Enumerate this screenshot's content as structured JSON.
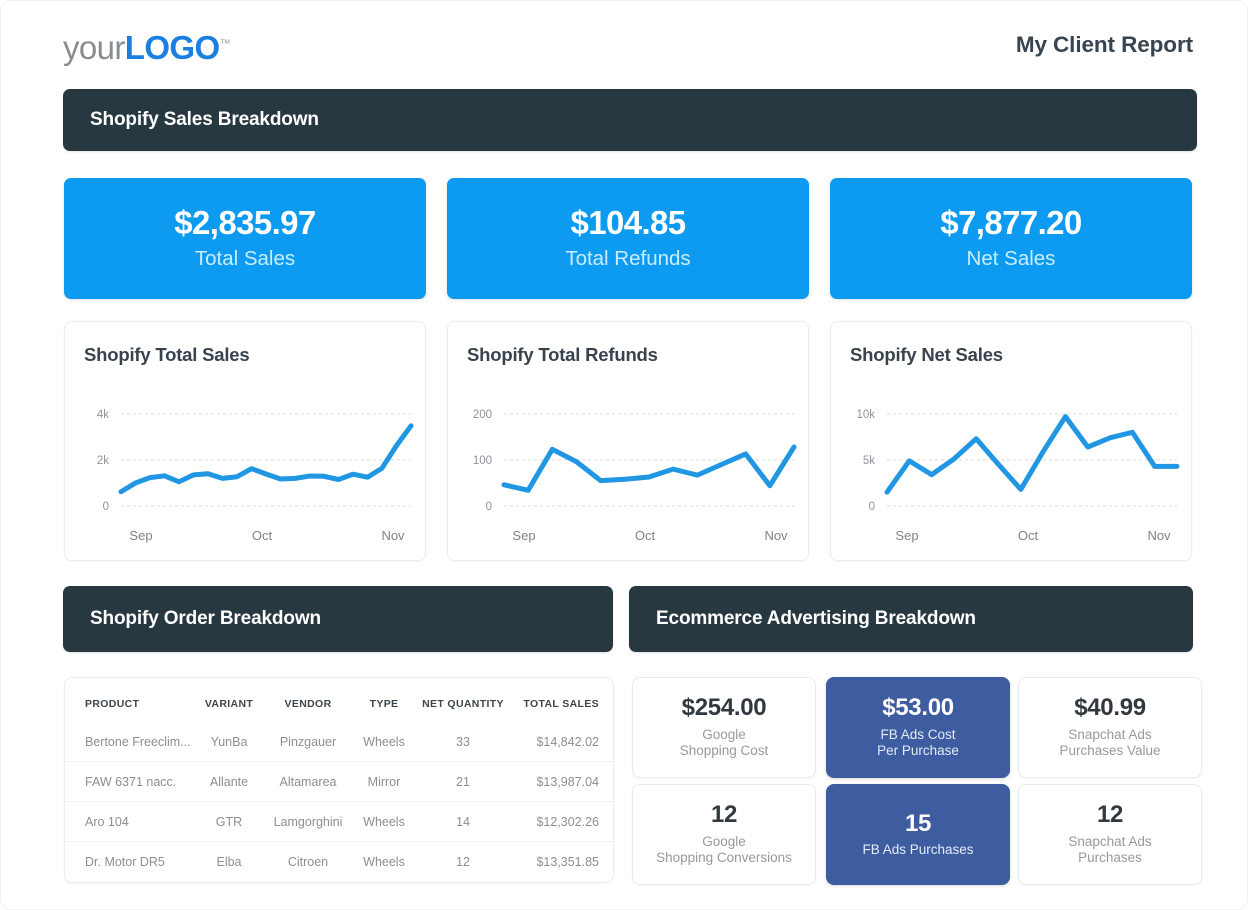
{
  "header": {
    "logo_primary": "your",
    "logo_accent": "LOGO",
    "logo_tm": "™",
    "report_title": "My Client Report"
  },
  "sections": {
    "sales_breakdown": "Shopify Sales Breakdown",
    "order_breakdown": "Shopify Order Breakdown",
    "advertising_breakdown": "Ecommerce Advertising Breakdown"
  },
  "colors": {
    "accent_blue": "#0d9bf2",
    "dark_bar": "#283841",
    "line_blue": "#2196e3",
    "fb_card_blue": "#3e5ca0"
  },
  "kpis": [
    {
      "value": "$2,835.97",
      "label": "Total Sales"
    },
    {
      "value": "$104.85",
      "label": "Total Refunds"
    },
    {
      "value": "$7,877.20",
      "label": "Net Sales"
    }
  ],
  "ad_cards": [
    {
      "value": "$254.00",
      "label": "Google\nShopping Cost",
      "style": "light"
    },
    {
      "value": "$53.00",
      "label": "FB Ads Cost\nPer Purchase",
      "style": "dark"
    },
    {
      "value": "$40.99",
      "label": "Snapchat Ads\nPurchases Value",
      "style": "light"
    },
    {
      "value": "12",
      "label": "Google\nShopping Conversions",
      "style": "light"
    },
    {
      "value": "15",
      "label": "FB Ads Purchases",
      "style": "dark"
    },
    {
      "value": "12",
      "label": "Snapchat Ads\nPurchases",
      "style": "light"
    }
  ],
  "order_table": {
    "columns": [
      "PRODUCT",
      "VARIANT",
      "VENDOR",
      "TYPE",
      "NET QUANTITY",
      "TOTAL SALES"
    ],
    "rows": [
      [
        "Bertone Freeclim...",
        "YunBa",
        "Pinzgauer",
        "Wheels",
        "33",
        "$14,842.02"
      ],
      [
        "FAW 6371 nacc.",
        "Allante",
        "Altamarea",
        "Mirror",
        "21",
        "$13,987.04"
      ],
      [
        "Aro 104",
        "GTR",
        "Lamgorghini",
        "Wheels",
        "14",
        "$12,302.26"
      ],
      [
        "Dr. Motor DR5",
        "Elba",
        "Citroen",
        "Wheels",
        "12",
        "$13,351.85"
      ]
    ]
  },
  "chart_data": [
    {
      "type": "line",
      "title": "Shopify Total Sales",
      "xlabel": "",
      "ylabel": "",
      "ylim": [
        0,
        4600
      ],
      "yticks": [
        0,
        2000,
        4000
      ],
      "ytick_labels": [
        "0",
        "2k",
        "4k"
      ],
      "xticks": [
        0,
        8,
        19
      ],
      "xtick_labels": [
        "Sep",
        "Oct",
        "Nov"
      ],
      "grid": true,
      "legend": "none",
      "x": [
        0,
        1,
        2,
        3,
        4,
        5,
        6,
        7,
        8,
        9,
        10,
        11,
        12,
        13,
        14,
        15,
        16,
        17,
        18,
        19
      ],
      "values": [
        620,
        1000,
        1230,
        1310,
        1050,
        1350,
        1400,
        1200,
        1270,
        1620,
        1390,
        1170,
        1200,
        1300,
        1290,
        1150,
        1380,
        1250,
        1640,
        2620,
        3480
      ]
    },
    {
      "type": "line",
      "title": "Shopify Total Refunds",
      "xlabel": "",
      "ylabel": "",
      "ylim": [
        0,
        230
      ],
      "yticks": [
        0,
        100,
        200
      ],
      "ytick_labels": [
        "0",
        "100",
        "200"
      ],
      "xticks": [
        0,
        8,
        19
      ],
      "xtick_labels": [
        "Sep",
        "Oct",
        "Nov"
      ],
      "grid": true,
      "legend": "none",
      "x": [
        0,
        1,
        2,
        3,
        4,
        5,
        6,
        7,
        8,
        9,
        10,
        11,
        12,
        13,
        14,
        15,
        16,
        17,
        18,
        19
      ],
      "values": [
        46,
        34,
        123,
        96,
        55,
        58,
        63,
        80,
        67,
        90,
        113,
        44,
        128
      ]
    },
    {
      "type": "line",
      "title": "Shopify Net Sales",
      "xlabel": "",
      "ylabel": "",
      "ylim": [
        0,
        11500
      ],
      "yticks": [
        0,
        5000,
        10000
      ],
      "ytick_labels": [
        "0",
        "5k",
        "10k"
      ],
      "xticks": [
        0,
        8,
        19
      ],
      "xtick_labels": [
        "Sep",
        "Oct",
        "Nov"
      ],
      "grid": true,
      "legend": "none",
      "x": [
        0,
        1,
        2,
        3,
        4,
        5,
        6,
        7,
        8,
        9,
        10,
        11,
        12,
        13,
        14,
        15,
        16,
        17,
        18,
        19
      ],
      "values": [
        1500,
        4900,
        3400,
        5100,
        7300,
        4500,
        1800,
        5900,
        9700,
        6400,
        7400,
        8000,
        4300,
        4300
      ]
    }
  ]
}
